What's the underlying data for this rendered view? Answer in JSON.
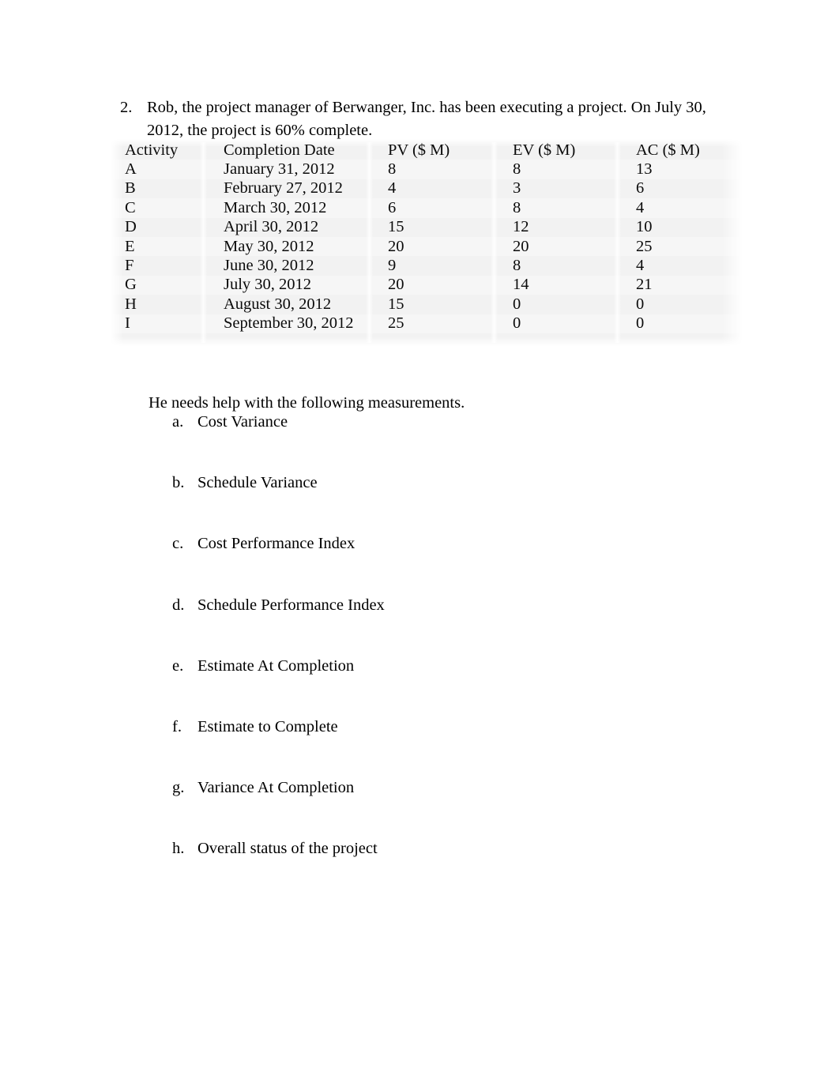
{
  "question": {
    "number": "2.",
    "text": "Rob, the project manager of Berwanger, Inc. has been executing a project. On July 30, 2012, the project is 60% complete."
  },
  "table": {
    "columns": [
      "Activity",
      "Completion Date",
      "PV ($ M)",
      "EV ($ M)",
      "AC ($ M)"
    ],
    "rows": [
      {
        "activity": "A",
        "date": "January 31, 2012",
        "pv": "8",
        "ev": "8",
        "ac": "13"
      },
      {
        "activity": "B",
        "date": "February 27, 2012",
        "pv": "4",
        "ev": "3",
        "ac": "6"
      },
      {
        "activity": "C",
        "date": "March 30, 2012",
        "pv": "6",
        "ev": "8",
        "ac": "4"
      },
      {
        "activity": "D",
        "date": "April 30, 2012",
        "pv": "15",
        "ev": "12",
        "ac": "10"
      },
      {
        "activity": "E",
        "date": "May 30, 2012",
        "pv": "20",
        "ev": "20",
        "ac": "25"
      },
      {
        "activity": "F",
        "date": "June 30, 2012",
        "pv": "9",
        "ev": "8",
        "ac": "4"
      },
      {
        "activity": "G",
        "date": "July 30, 2012",
        "pv": "20",
        "ev": "14",
        "ac": "21"
      },
      {
        "activity": "H",
        "date": "August 30, 2012",
        "pv": "15",
        "ev": "0",
        "ac": "0"
      },
      {
        "activity": "I",
        "date": "September 30, 2012",
        "pv": "25",
        "ev": "0",
        "ac": "0"
      }
    ]
  },
  "measurements": {
    "intro": "He needs help with the following measurements.",
    "items": [
      {
        "marker": "a.",
        "label": "Cost Variance"
      },
      {
        "marker": "b.",
        "label": "Schedule Variance"
      },
      {
        "marker": "c.",
        "label": "Cost Performance Index"
      },
      {
        "marker": "d.",
        "label": "Schedule Performance Index"
      },
      {
        "marker": "e.",
        "label": "Estimate At Completion"
      },
      {
        "marker": "f.",
        "label": "Estimate to Complete"
      },
      {
        "marker": "g.",
        "label": "Variance At Completion"
      },
      {
        "marker": "h.",
        "label": "Overall status of the project"
      }
    ]
  }
}
